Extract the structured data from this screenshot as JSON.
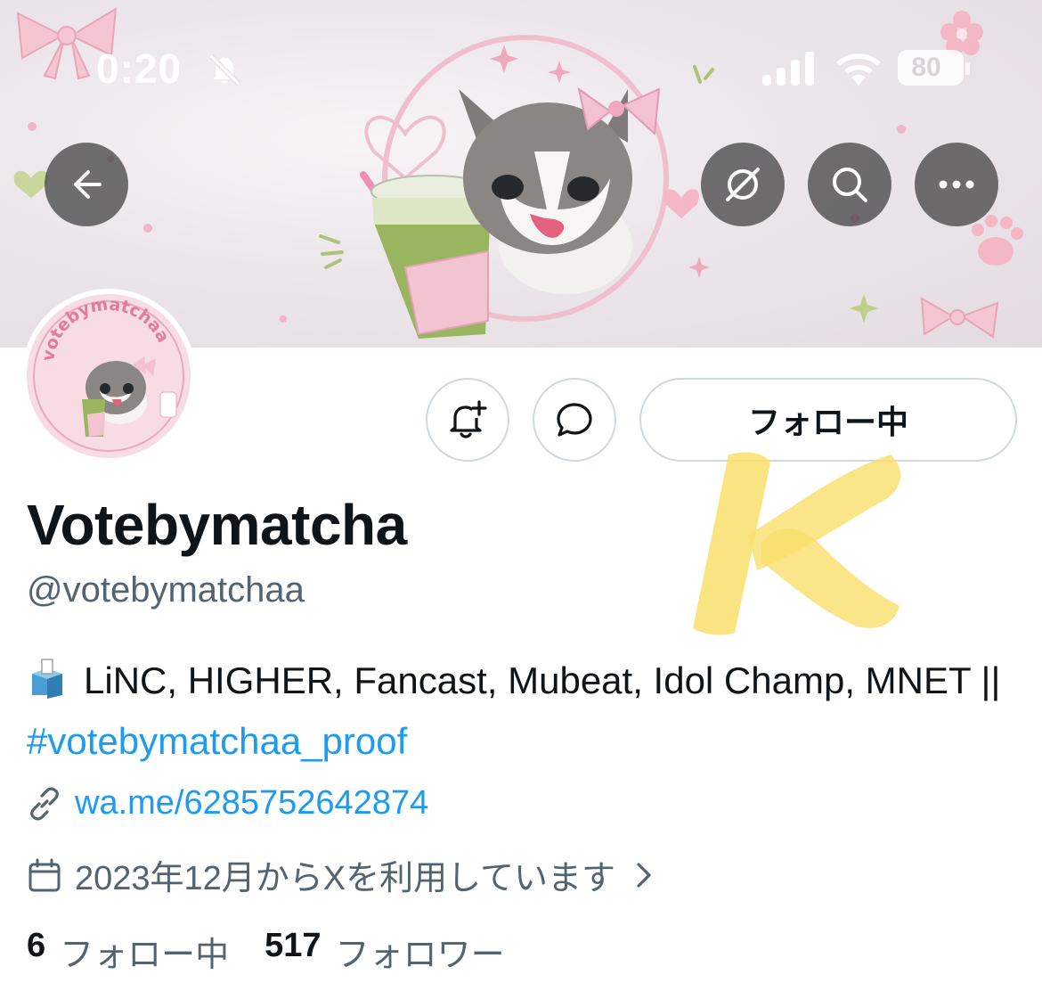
{
  "status_bar": {
    "time": "0:20",
    "battery": "80"
  },
  "header": {
    "back_icon": "arrow-left-icon",
    "actions": [
      "grok-icon",
      "search-icon",
      "more-icon"
    ]
  },
  "profile": {
    "display_name": "Votebymatcha",
    "handle": "@votebymatchaa",
    "follow_label": "フォロー中",
    "bio_text": "LiNC, HIGHER, Fancast, Mubeat, Idol Champ, MNET || ",
    "bio_hashtag": "#votebymatchaa_proof",
    "link": "wa.me/6285752642874",
    "joined": "2023年12月からXを利用しています",
    "following_count": "6",
    "following_label": "フォロー中",
    "followers_count": "517",
    "followers_label": "フォロワー"
  },
  "avatar": {
    "logo_text": "votebymatchaa"
  },
  "watermark": {
    "letter": "K"
  },
  "colors": {
    "accent": "#1d9bf0",
    "muted": "#536471",
    "text": "#0f1419",
    "border": "#cfd9de"
  }
}
